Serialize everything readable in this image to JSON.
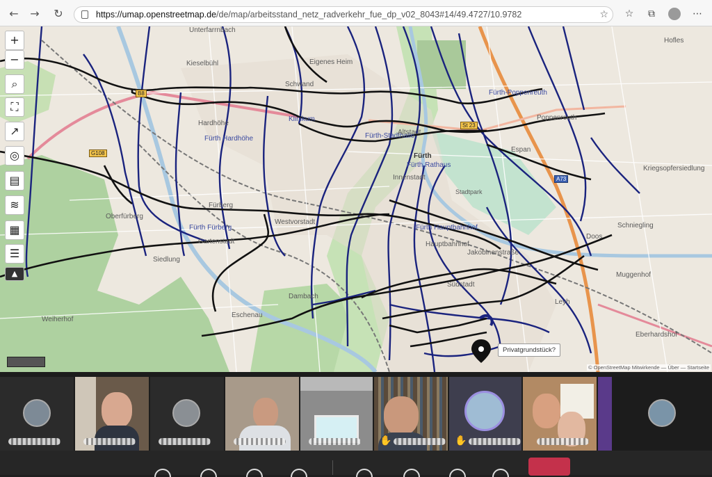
{
  "browser": {
    "url_host": "https://umap.openstreetmap.de",
    "url_path": "/de/map/arbeitsstand_netz_radverkehr_fue_dp_v02_8043#14/49.4727/10.9782",
    "buttons": {
      "back": "←",
      "forward": "→",
      "reload": "↻"
    }
  },
  "map": {
    "controls": [
      "zoom-in",
      "zoom-out",
      "search",
      "fullscreen",
      "share",
      "locate",
      "measure",
      "layers",
      "edit",
      "data"
    ],
    "zoom_in_label": "+",
    "zoom_out_label": "−",
    "place_labels": {
      "unterfarrnbach": "Unterfarrnbach",
      "kieselbuhl": "Kieselbühl",
      "eigenes_heim": "Eigenes Heim",
      "schwand": "Schwand",
      "hardhohe": "Hardhöhe",
      "furth_hardhohe": "Fürth Hardhöhe",
      "klinikum": "Klinikum",
      "furth_stadthalle": "Fürth-Stadthalle",
      "altstadt": "Altstadt",
      "furth": "Fürth",
      "furth_rathaus": "Fürth Rathaus",
      "innenstadt": "Innenstadt",
      "espan": "Espan",
      "poppenreuth": "Poppenreuth",
      "furth_poppenreuth": "Fürth-Poppenreuth",
      "hofles": "Hofles",
      "kriegsopfersiedlung": "Kriegsopfersiedlung",
      "oberfurberg": "Oberfürberg",
      "furberg": "Fürberg",
      "westvorstadt": "Westvorstadt",
      "furth_furberg": "Fürth Fürberg",
      "stadtpark": "Stadtpark",
      "furth_hauptbahnhof": "Fürth Hauptbahnhof",
      "hauptbahnhof": "Hauptbahnhof",
      "jakobinenstrasse": "Jakobinenstraße",
      "schniegling": "Schniegling",
      "doos": "Doos",
      "muggenhof": "Muggenhof",
      "dambach": "Dambach",
      "eschenau": "Eschenau",
      "weiherhof": "Weiherhof",
      "leyh": "Leyh",
      "eberhardshof": "Eberhardshof",
      "sudstadt": "Südstadt",
      "gartenstadt": "Gartenstadt",
      "siedlung": "Siedlung"
    },
    "road_badges": {
      "g108": "G108",
      "b8": "B8",
      "st": "St 23",
      "a73": "A73"
    },
    "popup_text": "Privatgrundstück?",
    "attribution": "© OpenStreetMap Mitwirkende — Über — Startseite"
  },
  "meeting": {
    "tiles": [
      {
        "type": "avatar"
      },
      {
        "type": "video"
      },
      {
        "type": "avatar"
      },
      {
        "type": "video"
      },
      {
        "type": "video"
      },
      {
        "type": "video",
        "hand_raised": true
      },
      {
        "type": "avatar",
        "hand_raised": true
      },
      {
        "type": "video"
      },
      {
        "type": "avatar"
      }
    ],
    "hand_icon": "✋",
    "colors": {
      "leave": "#c4314b"
    }
  }
}
